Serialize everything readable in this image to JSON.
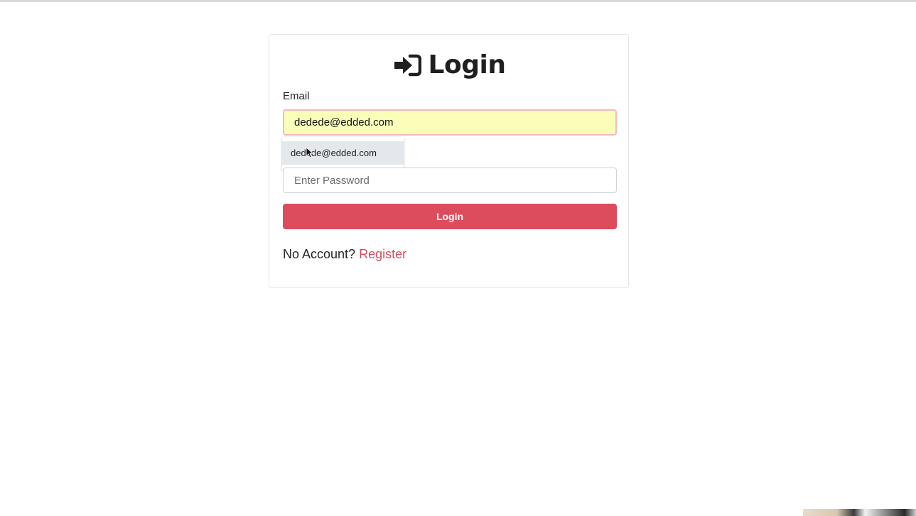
{
  "header": {
    "title": "Login",
    "title_icon": "sign-in-icon"
  },
  "form": {
    "email_label": "Email",
    "email_value": "dedede@edded.com",
    "autocomplete_suggestion": "dedede@edded.com",
    "password_placeholder": "Enter Password",
    "submit_label": "Login"
  },
  "footer": {
    "prompt": "No Account?",
    "register_link": "Register"
  },
  "colors": {
    "accent": "#dc4c5c",
    "autofill_background": "#fafeb9",
    "text": "#212529"
  }
}
